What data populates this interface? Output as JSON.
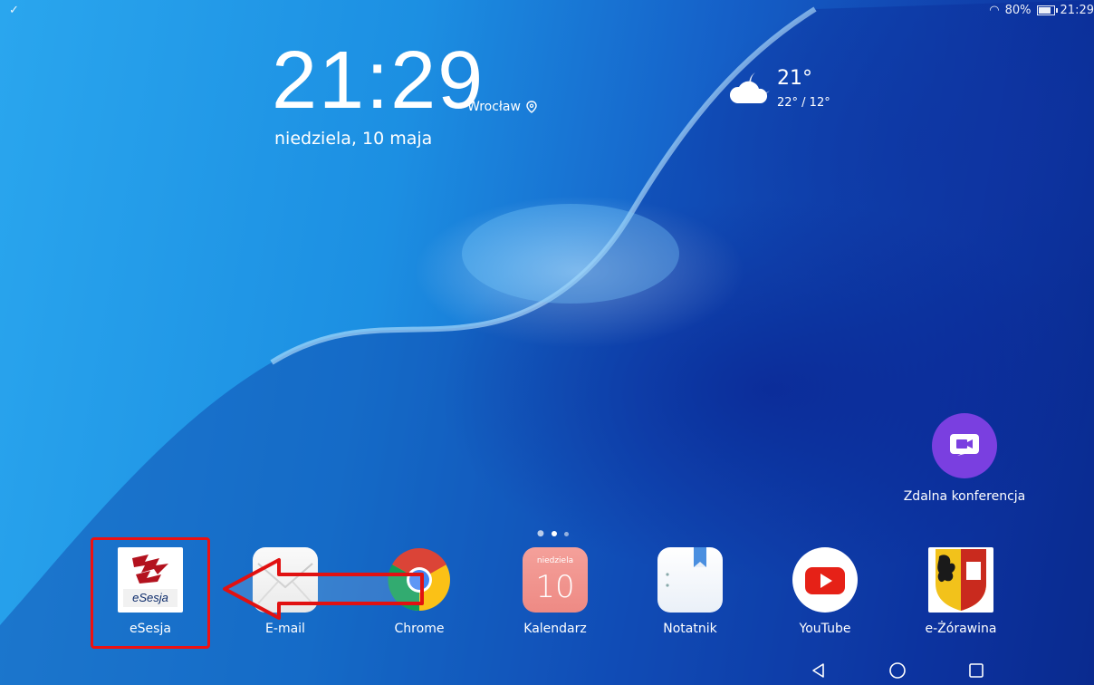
{
  "status_bar": {
    "battery": "80%",
    "time": "21:29"
  },
  "clock_widget": {
    "time": "21:29",
    "city": "Wrocław",
    "date": "niedziela, 10 maja"
  },
  "weather_widget": {
    "temperature": "21°",
    "range": "22° / 12°"
  },
  "home_apps": [
    {
      "label": "Zdalna konferencja",
      "icon": "video-camera-icon",
      "color": "#7a3fe0"
    }
  ],
  "dock": {
    "apps": [
      {
        "label": "eSesja",
        "icon": "esesja-logo-icon",
        "logo_text": "eSesja"
      },
      {
        "label": "E-mail",
        "icon": "envelope-icon"
      },
      {
        "label": "Chrome",
        "icon": "chrome-icon"
      },
      {
        "label": "Kalendarz",
        "icon": "calendar-icon",
        "day_name": "niedziela",
        "day_number": "10"
      },
      {
        "label": "Notatnik",
        "icon": "notepad-icon"
      },
      {
        "label": "YouTube",
        "icon": "youtube-icon"
      },
      {
        "label": "e-Żórawina",
        "icon": "coat-of-arms-icon"
      }
    ]
  },
  "page_indicator": {
    "pages": 3,
    "current": 2
  },
  "annotation": {
    "highlight_color": "#e11111",
    "arrow_target": "eSesja"
  }
}
